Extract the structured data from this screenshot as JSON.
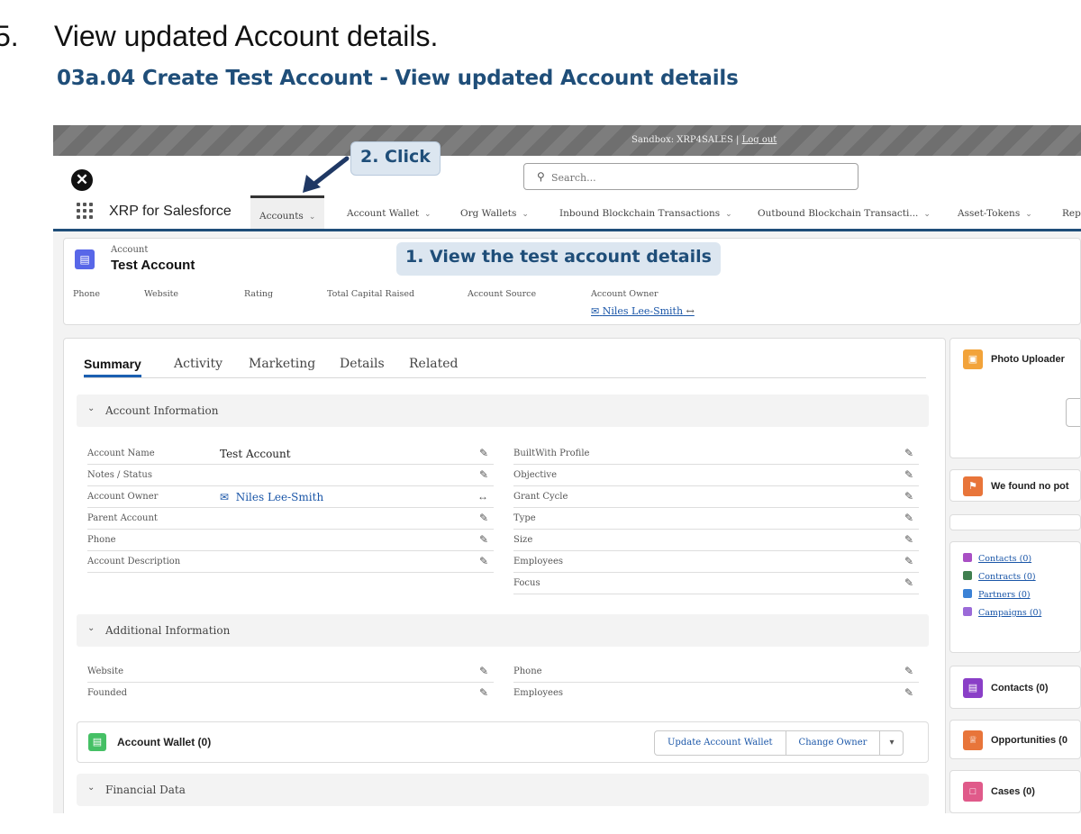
{
  "heading": {
    "step_number": "5.",
    "step_text": "View updated Account details.",
    "subtitle": "03a.04 Create Test Account - View updated Account details"
  },
  "sandbox_bar": {
    "text": "Sandbox: XRP4SALES | ",
    "logout_label": "Log out"
  },
  "search": {
    "placeholder": "Search..."
  },
  "nav": {
    "app_name": "XRP for Salesforce",
    "items": [
      {
        "label": "Accounts"
      },
      {
        "label": "Account Wallet"
      },
      {
        "label": "Org Wallets"
      },
      {
        "label": "Inbound Blockchain Transactions"
      },
      {
        "label": "Outbound Blockchain Transacti..."
      },
      {
        "label": "Asset-Tokens"
      },
      {
        "label": "Rep"
      }
    ]
  },
  "record_header": {
    "object_label": "Account",
    "record_name": "Test Account",
    "fields": [
      {
        "label": "Phone"
      },
      {
        "label": "Website"
      },
      {
        "label": "Rating"
      },
      {
        "label": "Total Capital Raised"
      },
      {
        "label": "Account Source"
      },
      {
        "label": "Account Owner"
      }
    ],
    "owner_name": "Niles Lee-Smith"
  },
  "tabs": [
    {
      "label": "Summary"
    },
    {
      "label": "Activity"
    },
    {
      "label": "Marketing"
    },
    {
      "label": "Details"
    },
    {
      "label": "Related"
    }
  ],
  "account_information": {
    "title": "Account Information",
    "left_fields": [
      {
        "label": "Account Name",
        "value": "Test Account"
      },
      {
        "label": "Notes / Status",
        "value": ""
      },
      {
        "label": "Account Owner",
        "value": "Niles Lee-Smith"
      },
      {
        "label": "Parent Account",
        "value": ""
      },
      {
        "label": "Phone",
        "value": ""
      },
      {
        "label": "Account Description",
        "value": ""
      }
    ],
    "right_fields": [
      {
        "label": "BuiltWith Profile"
      },
      {
        "label": "Objective"
      },
      {
        "label": "Grant Cycle"
      },
      {
        "label": "Type"
      },
      {
        "label": "Size"
      },
      {
        "label": "Employees"
      },
      {
        "label": "Focus"
      }
    ]
  },
  "additional_information": {
    "title": "Additional Information",
    "left_fields": [
      {
        "label": "Website"
      },
      {
        "label": "Founded"
      }
    ],
    "right_fields": [
      {
        "label": "Phone"
      },
      {
        "label": "Employees"
      }
    ]
  },
  "account_wallet": {
    "title": "Account Wallet (0)",
    "update_label": "Update Account Wallet",
    "change_owner_label": "Change Owner"
  },
  "financial_data": {
    "title": "Financial Data"
  },
  "sidebar": {
    "photo_uploader": "Photo Uploader",
    "found_no": "We found no pot",
    "links": [
      {
        "label": "Contacts (0)",
        "color": "#a94fc4"
      },
      {
        "label": "Contracts (0)",
        "color": "#3f7f4f"
      },
      {
        "label": "Partners (0)",
        "color": "#3b82d6"
      },
      {
        "label": "Campaigns (0)",
        "color": "#9b6ad8"
      }
    ],
    "contacts": "Contacts (0)",
    "opportunities": "Opportunities (0",
    "cases": "Cases (0)"
  },
  "annotations": {
    "view_details": "1. View the test account details",
    "click": "2. Click"
  },
  "colors": {
    "heading_blue": "#1f4e79",
    "link_blue": "#1a56a8",
    "callout_bg": "#dce6f0",
    "record_icon": "#5867e8",
    "wallet_icon": "#45c065"
  }
}
